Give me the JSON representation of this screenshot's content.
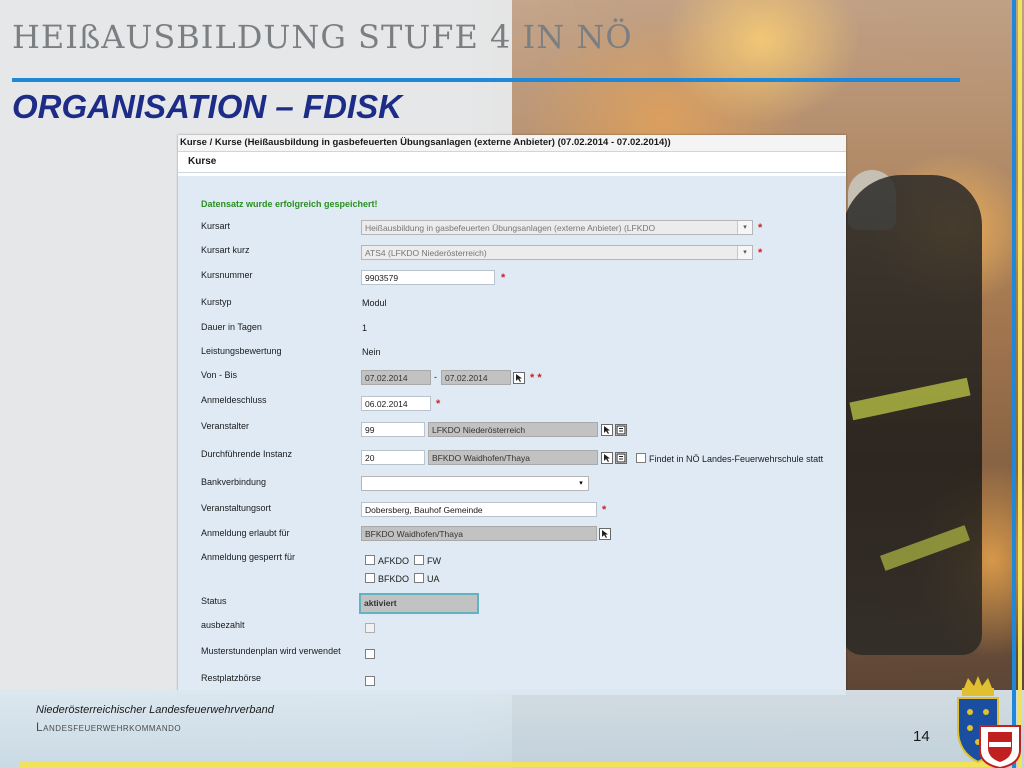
{
  "slide": {
    "header_title": "HEIßAUSBILDUNG STUFE 4 IN NÖ",
    "heading": "ORGANISATION – FDISK",
    "footer_org": "Niederösterreichischer Landesfeuerwehrverband",
    "footer_unit": "Landesfeuerwehrkommando",
    "page_number": "14",
    "colors": {
      "accent_blue": "#1f88d8",
      "heading_blue": "#1d2c86",
      "accent_yellow": "#f0e25a"
    }
  },
  "screenshot": {
    "breadcrumb": "Kurse / Kurse (Heißausbildung in gasbefeuerten Übungsanlagen (externe Anbieter) (07.02.2014 - 07.02.2014))",
    "section_title": "Kurse",
    "success_message": "Datensatz wurde erfolgreich gespeichert!",
    "required_mark": "*",
    "required_mark_double": "* *",
    "range_separator": "-",
    "fields": {
      "kursart": {
        "label": "Kursart",
        "value": "Heißausbildung in gasbefeuerten Übungsanlagen (externe Anbieter) (LFKDO"
      },
      "kursart_kurz": {
        "label": "Kursart kurz",
        "value": "ATS4 (LFKDO Niederösterreich)"
      },
      "kursnummer": {
        "label": "Kursnummer",
        "value": "9903579"
      },
      "kurstyp": {
        "label": "Kurstyp",
        "value": "Modul"
      },
      "dauer": {
        "label": "Dauer in Tagen",
        "value": "1"
      },
      "leistungsbewertung": {
        "label": "Leistungsbewertung",
        "value": "Nein"
      },
      "von_bis": {
        "label": "Von - Bis",
        "from": "07.02.2014",
        "to": "07.02.2014"
      },
      "anmeldeschluss": {
        "label": "Anmeldeschluss",
        "value": "06.02.2014"
      },
      "veranstalter": {
        "label": "Veranstalter",
        "code": "99",
        "name": "LFKDO Niederösterreich"
      },
      "durchfuehrende_instanz": {
        "label": "Durchführende Instanz",
        "code": "20",
        "name": "BFKDO Waidhofen/Thaya",
        "checkbox_label": "Findet in NÖ Landes-Feuerwehrschule statt"
      },
      "bankverbindung": {
        "label": "Bankverbindung",
        "value": ""
      },
      "veranstaltungsort": {
        "label": "Veranstaltungsort",
        "value": "Dobersberg, Bauhof Gemeinde"
      },
      "anmeldung_erlaubt": {
        "label": "Anmeldung erlaubt für",
        "value": "BFKDO Waidhofen/Thaya"
      },
      "anmeldung_gesperrt": {
        "label": "Anmeldung gesperrt für",
        "options": [
          "AFKDO",
          "FW",
          "BFKDO",
          "UA"
        ]
      },
      "status": {
        "label": "Status",
        "value": "aktiviert"
      },
      "ausbezahlt": {
        "label": "ausbezahlt"
      },
      "musterstundenplan": {
        "label": "Musterstundenplan wird verwendet"
      },
      "restplatzboerse": {
        "label": "Restplatzbörse"
      }
    }
  }
}
